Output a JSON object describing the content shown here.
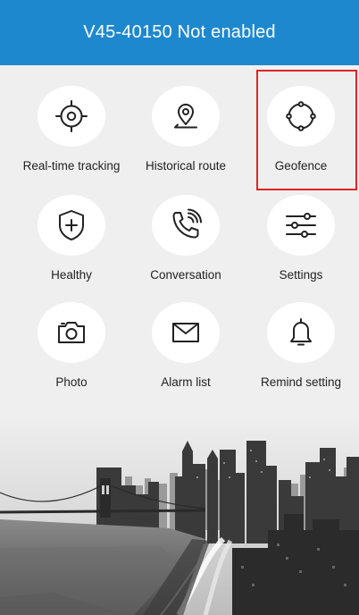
{
  "header": {
    "title": "V45-40150 Not enabled"
  },
  "menu": {
    "items": [
      {
        "label": "Real-time tracking",
        "icon": "crosshair-icon"
      },
      {
        "label": "Historical route",
        "icon": "location-pin-icon"
      },
      {
        "label": "Geofence",
        "icon": "geofence-icon",
        "highlighted": true
      },
      {
        "label": "Healthy",
        "icon": "shield-plus-icon"
      },
      {
        "label": "Conversation",
        "icon": "phone-call-icon"
      },
      {
        "label": "Settings",
        "icon": "sliders-icon"
      },
      {
        "label": "Photo",
        "icon": "camera-icon"
      },
      {
        "label": "Alarm list",
        "icon": "envelope-icon"
      },
      {
        "label": "Remind setting",
        "icon": "bell-icon"
      }
    ]
  },
  "colors": {
    "header_bg": "#1e88cf",
    "highlight_border": "#e02525",
    "page_bg": "#efefef"
  }
}
